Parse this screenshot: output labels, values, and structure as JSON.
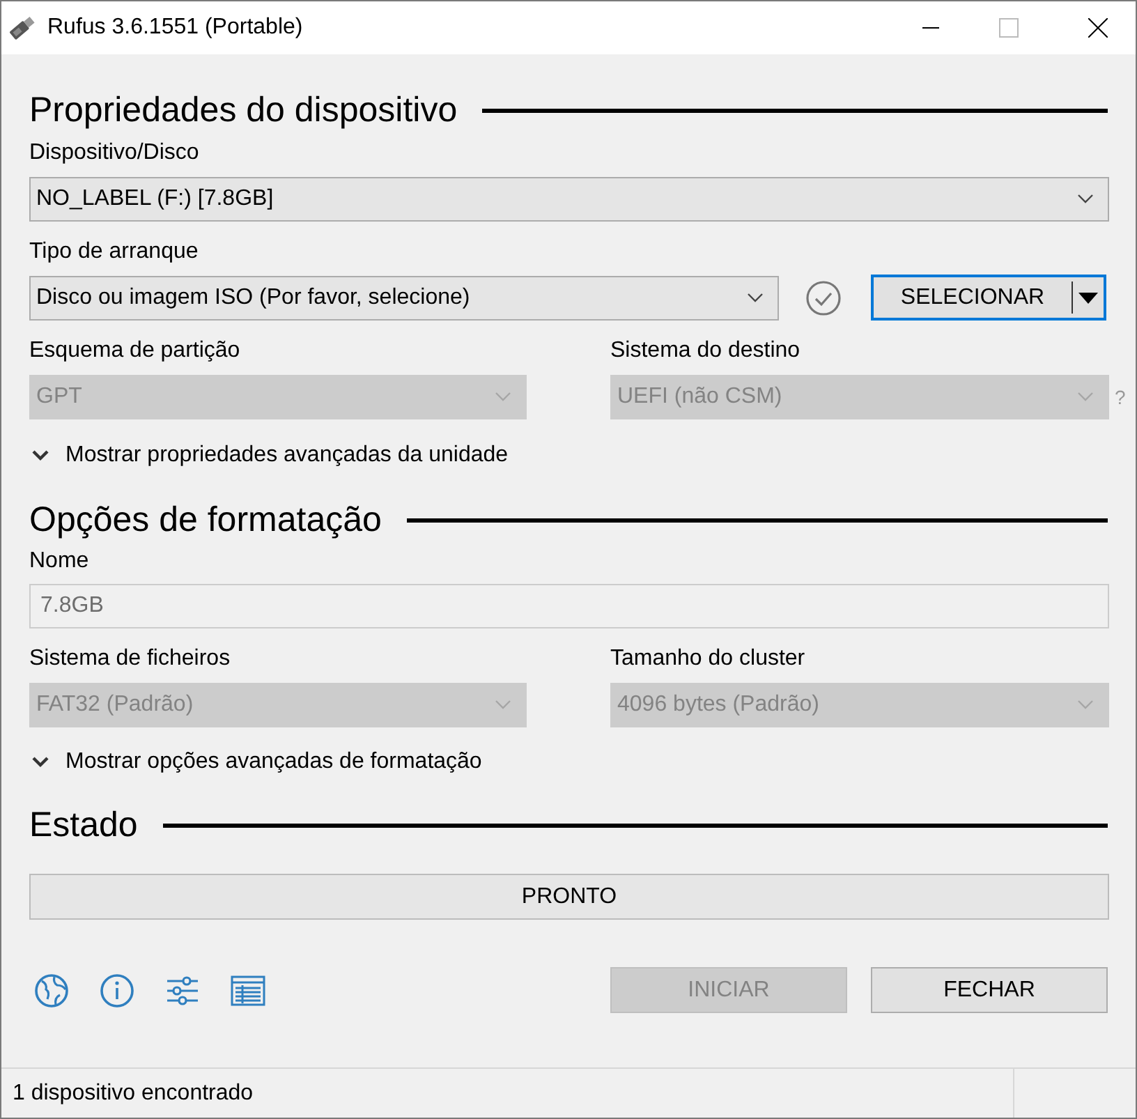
{
  "window": {
    "title": "Rufus 3.6.1551 (Portable)"
  },
  "device_properties": {
    "heading": "Propriedades do dispositivo",
    "device": {
      "label": "Dispositivo/Disco",
      "value": "NO_LABEL (F:) [7.8GB]",
      "disabled": false
    },
    "boot_selection": {
      "label": "Tipo de arranque",
      "value": "Disco ou imagem ISO (Por favor, selecione)",
      "disabled": false
    },
    "select_button": {
      "label": "SELECIONAR",
      "focused": true
    },
    "partition_scheme": {
      "label": "Esquema de partição",
      "value": "GPT",
      "disabled": true
    },
    "target_system": {
      "label": "Sistema do destino",
      "value": "UEFI (não CSM)",
      "disabled": true
    },
    "help": "?",
    "advanced": {
      "label": "Mostrar propriedades avançadas da unidade",
      "expanded": false
    }
  },
  "format_options": {
    "heading": "Opções de formatação",
    "volume_label": {
      "label": "Nome",
      "value": "7.8GB",
      "disabled": true
    },
    "file_system": {
      "label": "Sistema de ficheiros",
      "value": "FAT32 (Padrão)",
      "disabled": true
    },
    "cluster_size": {
      "label": "Tamanho do cluster",
      "value": "4096 bytes (Padrão)",
      "disabled": true
    },
    "advanced": {
      "label": "Mostrar opções avançadas de formatação",
      "expanded": false
    }
  },
  "status": {
    "heading": "Estado",
    "text": "PRONTO",
    "level": 0
  },
  "buttons": [
    {
      "label": "INICIAR",
      "disabled": true
    },
    {
      "label": "FECHAR",
      "disabled": false
    }
  ],
  "status_bar": {
    "text": "1 dispositivo encontrado"
  }
}
